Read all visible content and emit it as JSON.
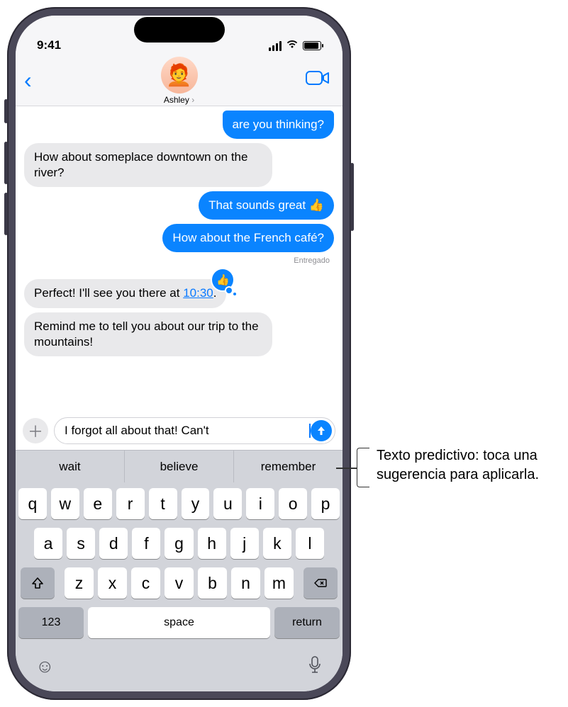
{
  "status": {
    "time": "9:41"
  },
  "contact": {
    "name": "Ashley"
  },
  "messages": {
    "m0": "are you thinking?",
    "m1": "How about someplace downtown on the river?",
    "m2": "That sounds great 👍",
    "m3": "How about the French café?",
    "delivered": "Entregado",
    "m4_pre": "Perfect! I'll see you there at ",
    "m4_link": "10:30",
    "m4_post": ".",
    "reaction": "👍",
    "m5": "Remind me to tell you about our trip to the mountains!"
  },
  "composer": {
    "text": "I forgot all about that! Can't "
  },
  "predictive": {
    "s1": "wait",
    "s2": "believe",
    "s3": "remember"
  },
  "keys": {
    "r1": [
      "q",
      "w",
      "e",
      "r",
      "t",
      "y",
      "u",
      "i",
      "o",
      "p"
    ],
    "r2": [
      "a",
      "s",
      "d",
      "f",
      "g",
      "h",
      "j",
      "k",
      "l"
    ],
    "r3": [
      "z",
      "x",
      "c",
      "v",
      "b",
      "n",
      "m"
    ],
    "num": "123",
    "space": "space",
    "return": "return"
  },
  "callout": "Texto predictivo: toca una sugerencia para aplicarla."
}
